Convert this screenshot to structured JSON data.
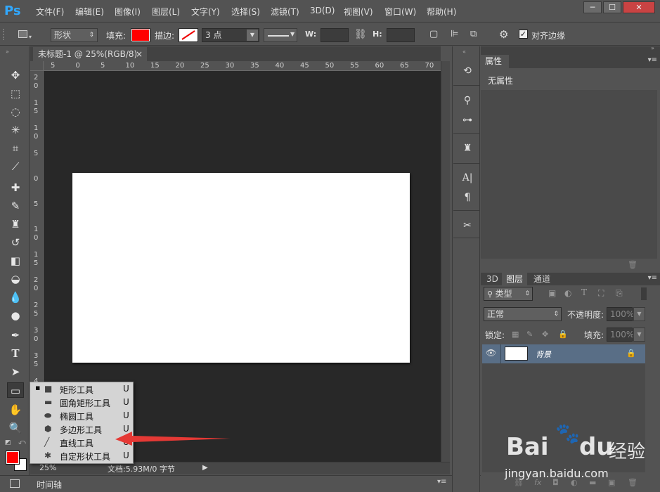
{
  "app": {
    "logo": "Ps"
  },
  "menu": [
    "文件(F)",
    "编辑(E)",
    "图像(I)",
    "图层(L)",
    "文字(Y)",
    "选择(S)",
    "滤镜(T)",
    "3D(D)",
    "视图(V)",
    "窗口(W)",
    "帮助(H)"
  ],
  "window_buttons": [
    "─",
    "☐",
    "✕"
  ],
  "options": {
    "mode": "形状",
    "fill_label": "填充:",
    "fill_color": "#ff0000",
    "stroke_label": "描边:",
    "stroke_size": "3 点",
    "w_label": "W:",
    "h_label": "H:",
    "align_edges": "对齐边缘"
  },
  "document": {
    "tab_title": "未标题-1 @ 25%(RGB/8)",
    "close": "×",
    "ruler_h": [
      "5",
      "0",
      "5",
      "10",
      "15",
      "20",
      "25",
      "30",
      "35",
      "40",
      "45",
      "50",
      "55",
      "60",
      "65",
      "70"
    ],
    "ruler_v": [
      [
        "2",
        "0"
      ],
      [
        "1",
        "5"
      ],
      [
        "1",
        "0"
      ],
      [
        "5"
      ],
      [
        "0"
      ],
      [
        "5"
      ],
      [
        "1",
        "0"
      ],
      [
        "1",
        "5"
      ],
      [
        "2",
        "0"
      ],
      [
        "2",
        "5"
      ],
      [
        "3",
        "0"
      ],
      [
        "3",
        "5"
      ],
      [
        "4"
      ]
    ],
    "zoom": "25%",
    "status": "文档:5.93M/0 字节"
  },
  "flyout": {
    "items": [
      {
        "name": "矩形工具",
        "key": "U",
        "icon": "rect-icon",
        "glyph": "■",
        "selected": true
      },
      {
        "name": "圆角矩形工具",
        "key": "U",
        "icon": "rounded-rect-icon",
        "glyph": "▬",
        "selected": false
      },
      {
        "name": "椭圆工具",
        "key": "U",
        "icon": "ellipse-icon",
        "glyph": "⬬",
        "selected": false
      },
      {
        "name": "多边形工具",
        "key": "U",
        "icon": "polygon-icon",
        "glyph": "⬢",
        "selected": false
      },
      {
        "name": "直线工具",
        "key": "U",
        "icon": "line-icon",
        "glyph": "╱",
        "selected": false
      },
      {
        "name": "自定形状工具",
        "key": "U",
        "icon": "custom-shape-icon",
        "glyph": "✱",
        "selected": false
      }
    ],
    "bullet": "▪"
  },
  "timeline": {
    "label": "时间轴"
  },
  "properties": {
    "tab": "属性",
    "content": "无属性"
  },
  "layers": {
    "tabs": [
      "3D",
      "图层",
      "通道"
    ],
    "filter_kind": "类型",
    "blend_mode": "正常",
    "opacity_label": "不透明度:",
    "opacity_value": "100%",
    "lock_label": "锁定:",
    "fill_label": "填充:",
    "fill_value": "100%",
    "layer_name": "背景"
  },
  "watermark": {
    "brand": "Bai",
    "brand2": "du",
    "suffix": "经验",
    "url": "jingyan.baidu.com"
  }
}
